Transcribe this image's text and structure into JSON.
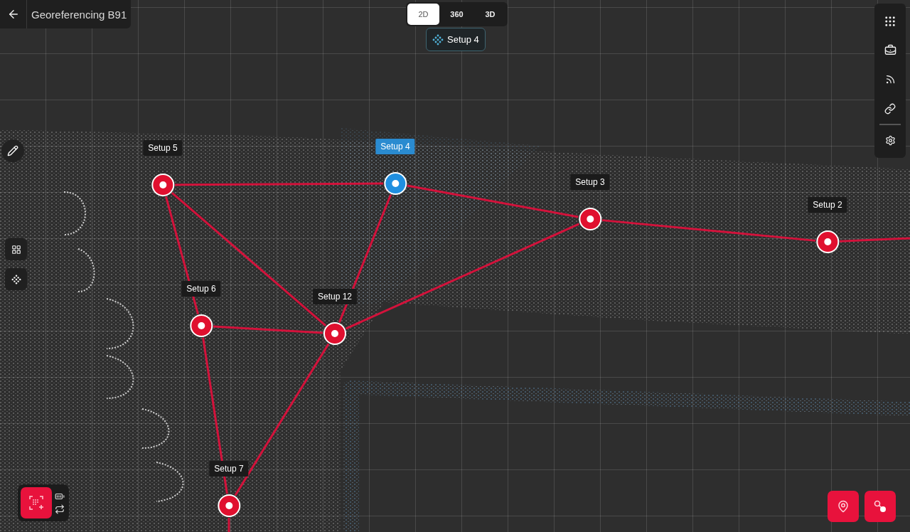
{
  "header": {
    "title": "Georeferencing B91"
  },
  "view_modes": [
    {
      "label": "2D",
      "selected": true
    },
    {
      "label": "360",
      "selected": false
    },
    {
      "label": "3D",
      "selected": false
    }
  ],
  "active_setup": {
    "label": "Setup 4"
  },
  "setups": [
    {
      "label": "Setup 5",
      "selected": false
    },
    {
      "label": "Setup 4",
      "selected": true
    },
    {
      "label": "Setup 3",
      "selected": false
    },
    {
      "label": "Setup 2",
      "selected": false
    },
    {
      "label": "Setup 6",
      "selected": false
    },
    {
      "label": "Setup 12",
      "selected": false
    },
    {
      "label": "Setup 7",
      "selected": false
    }
  ]
}
